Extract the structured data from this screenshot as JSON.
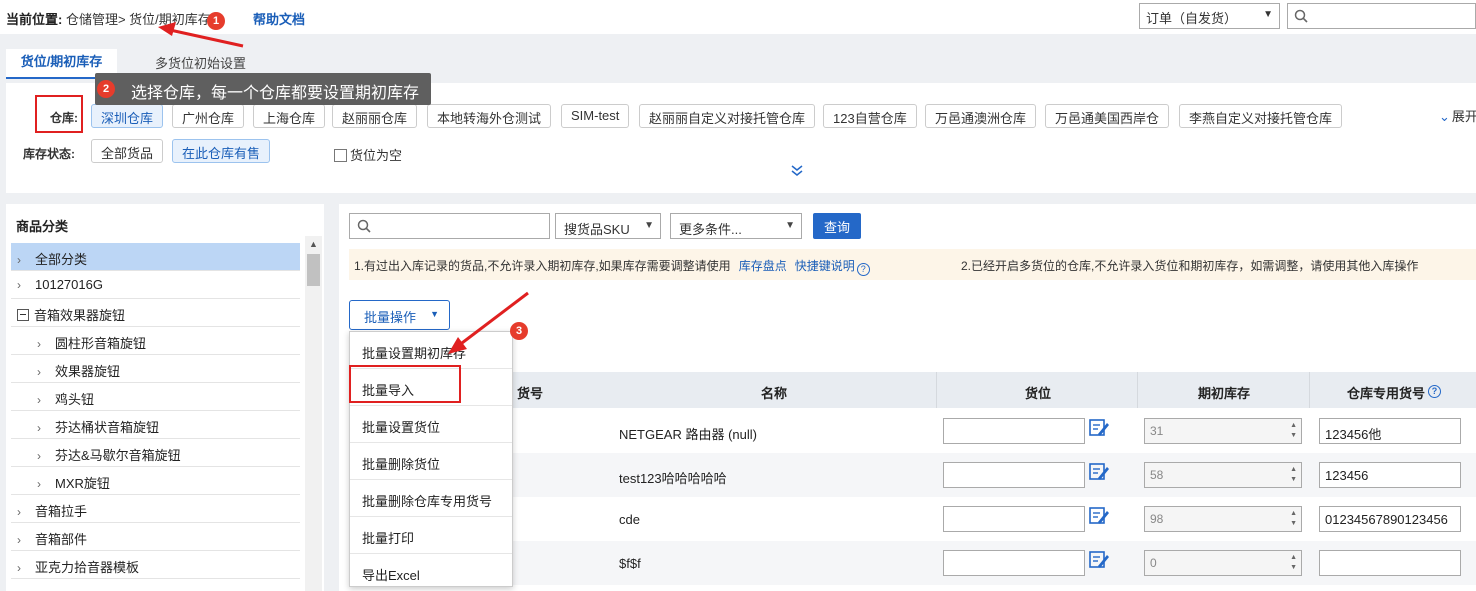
{
  "topbar": {
    "breadcrumb_label": "当前位置:",
    "breadcrumb_path": "仓储管理> 货位/期初库存",
    "help_link": "帮助文档",
    "order_select": "订单（自发货）"
  },
  "tabs": {
    "active": "货位/期初库存",
    "inactive": "多货位初始设置"
  },
  "tooltip": "选择仓库，每一个仓库都要设置期初库存",
  "badges": [
    "1",
    "2",
    "3"
  ],
  "warehouse": {
    "label": "仓库:",
    "chips": [
      "深圳仓库",
      "广州仓库",
      "上海仓库",
      "赵丽丽仓库",
      "本地转海外仓测试",
      "SIM-test",
      "赵丽丽自定义对接托管仓库",
      "123自营仓库",
      "万邑通澳洲仓库",
      "万邑通美国西岸仓",
      "李燕自定义对接托管仓库"
    ],
    "expand": "展开"
  },
  "stock_status": {
    "label": "库存状态:",
    "options": [
      "全部货品",
      "在此仓库有售"
    ],
    "empty_checkbox": "货位为空"
  },
  "categories": {
    "title": "商品分类",
    "items": [
      {
        "label": "全部分类"
      },
      {
        "label": "10127016G"
      },
      {
        "label": "音箱效果器旋钮"
      },
      {
        "label": "圆柱形音箱旋钮"
      },
      {
        "label": "效果器旋钮"
      },
      {
        "label": "鸡头钮"
      },
      {
        "label": "芬达桶状音箱旋钮"
      },
      {
        "label": "芬达&马歇尔音箱旋钮"
      },
      {
        "label": "MXR旋钮"
      },
      {
        "label": "音箱拉手"
      },
      {
        "label": "音箱部件"
      },
      {
        "label": "亚克力拾音器模板"
      }
    ]
  },
  "search": {
    "sku_select": "搜货品SKU",
    "more_select": "更多条件...",
    "query_button": "查询"
  },
  "notice": {
    "text1": "1.有过出入库记录的货品,不允许录入期初库存,如果库存需要调整请使用",
    "link1": "库存盘点",
    "link2": "快捷键说明",
    "text2": "2.已经开启多货位的仓库,不允许录入货位和期初库存，如需调整，请使用其他入库操作"
  },
  "batch": {
    "button": "批量操作",
    "menu": [
      "批量设置期初库存",
      "批量导入",
      "批量设置货位",
      "批量删除货位",
      "批量删除仓库专用货号",
      "批量打印",
      "导出Excel"
    ]
  },
  "table": {
    "headers": {
      "code": "货号",
      "name": "名称",
      "location": "货位",
      "initial_stock": "期初库存",
      "wh_code": "仓库专用货号"
    },
    "rows": [
      {
        "name": "NETGEAR 路由器 (null)",
        "stock": "31",
        "wh_code": "123456他"
      },
      {
        "name": "test123哈哈哈哈哈",
        "stock": "58",
        "wh_code": "123456"
      },
      {
        "name": "cde",
        "stock": "98",
        "wh_code": "01234567890123456"
      },
      {
        "name": "$f$f",
        "stock": "0",
        "wh_code": ""
      }
    ]
  },
  "colors": {
    "accent": "#2468c8",
    "annotation": "#e02020",
    "tooltip_bg": "#5f5f5f"
  }
}
